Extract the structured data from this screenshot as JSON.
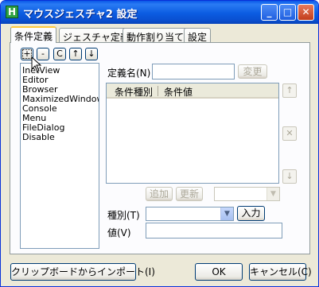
{
  "window": {
    "title": "マウスジェスチャ2 設定",
    "app_icon_letter": "H",
    "controls": {
      "minimize": "_",
      "maximize": "□",
      "close": "✕"
    }
  },
  "tabs": [
    "条件定義",
    "ジェスチャ定義",
    "動作割り当て",
    "設定"
  ],
  "list_toolbar": {
    "add": "+",
    "remove": "-",
    "copy": "C",
    "up": "↑",
    "down": "↓"
  },
  "conditions_list": [
    "InetView",
    "Editor",
    "Browser",
    "MaximizedWindow",
    "Console",
    "Menu",
    "FileDialog",
    "Disable"
  ],
  "definition": {
    "name_label": "定義名(N)",
    "name_value": "",
    "change_button": "変更"
  },
  "conditions_table": {
    "columns": [
      "条件種別",
      "条件値"
    ],
    "rows": []
  },
  "side_buttons": {
    "up": "↑",
    "delete": "✕",
    "down": "↓"
  },
  "row_actions": {
    "add": "追加",
    "update": "更新",
    "combo_value": ""
  },
  "kind": {
    "label": "種別(T)",
    "value": "",
    "input_button": "入力"
  },
  "value": {
    "label": "値(V)",
    "value": ""
  },
  "footer": {
    "import_button": "クリップボードからインポート(I)",
    "ok_button": "OK",
    "cancel_button": "キャンセル(C)"
  }
}
